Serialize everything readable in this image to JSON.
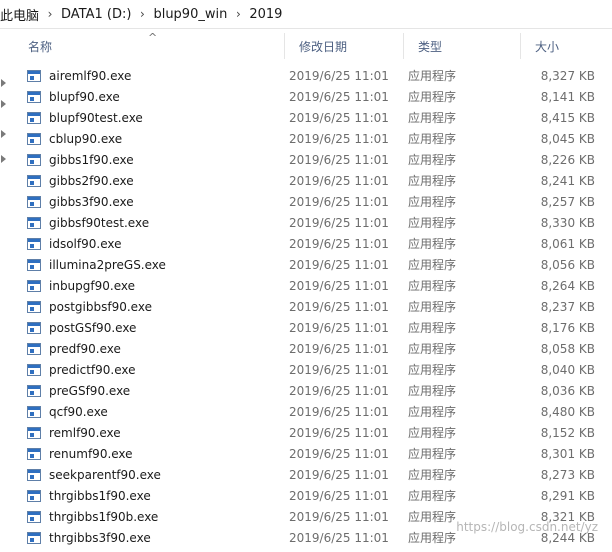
{
  "breadcrumb": [
    "此电脑",
    "DATA1 (D:)",
    "blup90_win",
    "2019"
  ],
  "columns": {
    "name": "名称",
    "date": "修改日期",
    "type": "类型",
    "size": "大小"
  },
  "files": [
    {
      "name": "airemlf90.exe",
      "date": "2019/6/25 11:01",
      "type": "应用程序",
      "size": "8,327 KB"
    },
    {
      "name": "blupf90.exe",
      "date": "2019/6/25 11:01",
      "type": "应用程序",
      "size": "8,141 KB"
    },
    {
      "name": "blupf90test.exe",
      "date": "2019/6/25 11:01",
      "type": "应用程序",
      "size": "8,415 KB"
    },
    {
      "name": "cblup90.exe",
      "date": "2019/6/25 11:01",
      "type": "应用程序",
      "size": "8,045 KB"
    },
    {
      "name": "gibbs1f90.exe",
      "date": "2019/6/25 11:01",
      "type": "应用程序",
      "size": "8,226 KB"
    },
    {
      "name": "gibbs2f90.exe",
      "date": "2019/6/25 11:01",
      "type": "应用程序",
      "size": "8,241 KB"
    },
    {
      "name": "gibbs3f90.exe",
      "date": "2019/6/25 11:01",
      "type": "应用程序",
      "size": "8,257 KB"
    },
    {
      "name": "gibbsf90test.exe",
      "date": "2019/6/25 11:01",
      "type": "应用程序",
      "size": "8,330 KB"
    },
    {
      "name": "idsolf90.exe",
      "date": "2019/6/25 11:01",
      "type": "应用程序",
      "size": "8,061 KB"
    },
    {
      "name": "illumina2preGS.exe",
      "date": "2019/6/25 11:01",
      "type": "应用程序",
      "size": "8,056 KB"
    },
    {
      "name": "inbupgf90.exe",
      "date": "2019/6/25 11:01",
      "type": "应用程序",
      "size": "8,264 KB"
    },
    {
      "name": "postgibbsf90.exe",
      "date": "2019/6/25 11:01",
      "type": "应用程序",
      "size": "8,237 KB"
    },
    {
      "name": "postGSf90.exe",
      "date": "2019/6/25 11:01",
      "type": "应用程序",
      "size": "8,176 KB"
    },
    {
      "name": "predf90.exe",
      "date": "2019/6/25 11:01",
      "type": "应用程序",
      "size": "8,058 KB"
    },
    {
      "name": "predictf90.exe",
      "date": "2019/6/25 11:01",
      "type": "应用程序",
      "size": "8,040 KB"
    },
    {
      "name": "preGSf90.exe",
      "date": "2019/6/25 11:01",
      "type": "应用程序",
      "size": "8,036 KB"
    },
    {
      "name": "qcf90.exe",
      "date": "2019/6/25 11:01",
      "type": "应用程序",
      "size": "8,480 KB"
    },
    {
      "name": "remlf90.exe",
      "date": "2019/6/25 11:01",
      "type": "应用程序",
      "size": "8,152 KB"
    },
    {
      "name": "renumf90.exe",
      "date": "2019/6/25 11:01",
      "type": "应用程序",
      "size": "8,301 KB"
    },
    {
      "name": "seekparentf90.exe",
      "date": "2019/6/25 11:01",
      "type": "应用程序",
      "size": "8,273 KB"
    },
    {
      "name": "thrgibbs1f90.exe",
      "date": "2019/6/25 11:01",
      "type": "应用程序",
      "size": "8,291 KB"
    },
    {
      "name": "thrgibbs1f90b.exe",
      "date": "2019/6/25 11:01",
      "type": "应用程序",
      "size": "8,321 KB"
    },
    {
      "name": "thrgibbs3f90.exe",
      "date": "2019/6/25 11:01",
      "type": "应用程序",
      "size": "8,244 KB"
    }
  ],
  "watermark": "https://blog.csdn.net/yz",
  "icons": {
    "file": "exe-file-icon",
    "sort": "sort-ascending-icon",
    "separator": "chevron-right-icon",
    "nav": "expand-arrow-icon"
  }
}
